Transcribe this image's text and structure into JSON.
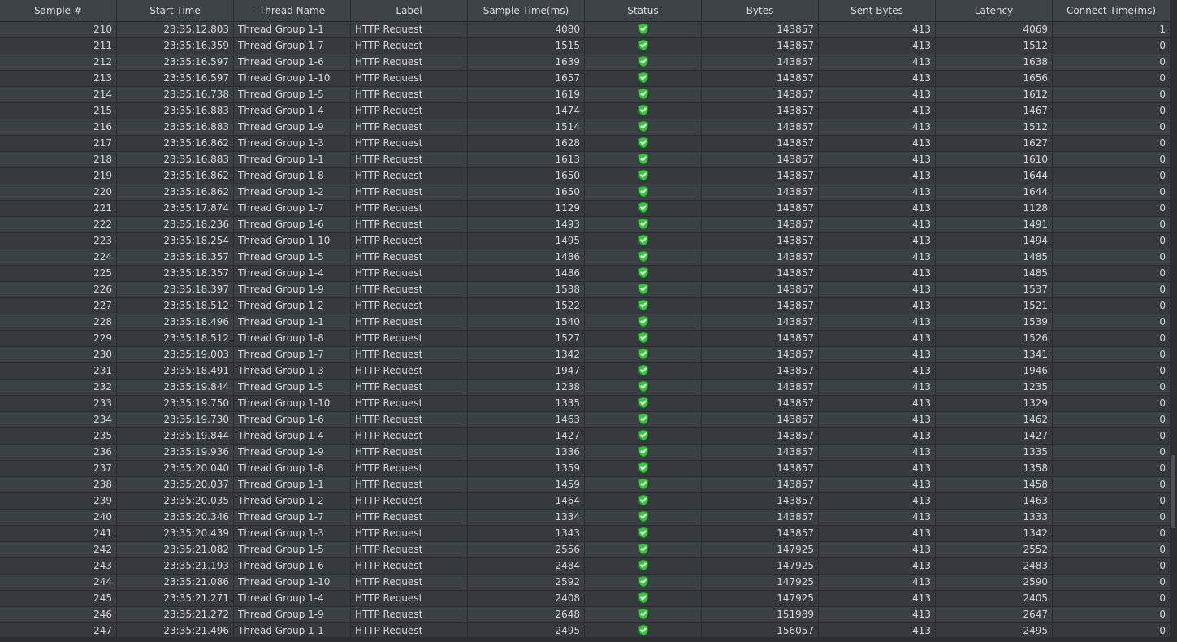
{
  "columns": [
    "Sample #",
    "Start Time",
    "Thread Name",
    "Label",
    "Sample Time(ms)",
    "Status",
    "Bytes",
    "Sent Bytes",
    "Latency",
    "Connect Time(ms)"
  ],
  "status_icon": "success-shield-icon",
  "colors": {
    "success": "#33c93a"
  },
  "rows": [
    [
      "210",
      "23:35:12.803",
      "Thread Group 1-1",
      "HTTP Request",
      "4080",
      "ok",
      "143857",
      "413",
      "4069",
      "1"
    ],
    [
      "211",
      "23:35:16.359",
      "Thread Group 1-7",
      "HTTP Request",
      "1515",
      "ok",
      "143857",
      "413",
      "1512",
      "0"
    ],
    [
      "212",
      "23:35:16.597",
      "Thread Group 1-6",
      "HTTP Request",
      "1639",
      "ok",
      "143857",
      "413",
      "1638",
      "0"
    ],
    [
      "213",
      "23:35:16.597",
      "Thread Group 1-10",
      "HTTP Request",
      "1657",
      "ok",
      "143857",
      "413",
      "1656",
      "0"
    ],
    [
      "214",
      "23:35:16.738",
      "Thread Group 1-5",
      "HTTP Request",
      "1619",
      "ok",
      "143857",
      "413",
      "1612",
      "0"
    ],
    [
      "215",
      "23:35:16.883",
      "Thread Group 1-4",
      "HTTP Request",
      "1474",
      "ok",
      "143857",
      "413",
      "1467",
      "0"
    ],
    [
      "216",
      "23:35:16.883",
      "Thread Group 1-9",
      "HTTP Request",
      "1514",
      "ok",
      "143857",
      "413",
      "1512",
      "0"
    ],
    [
      "217",
      "23:35:16.862",
      "Thread Group 1-3",
      "HTTP Request",
      "1628",
      "ok",
      "143857",
      "413",
      "1627",
      "0"
    ],
    [
      "218",
      "23:35:16.883",
      "Thread Group 1-1",
      "HTTP Request",
      "1613",
      "ok",
      "143857",
      "413",
      "1610",
      "0"
    ],
    [
      "219",
      "23:35:16.862",
      "Thread Group 1-8",
      "HTTP Request",
      "1650",
      "ok",
      "143857",
      "413",
      "1644",
      "0"
    ],
    [
      "220",
      "23:35:16.862",
      "Thread Group 1-2",
      "HTTP Request",
      "1650",
      "ok",
      "143857",
      "413",
      "1644",
      "0"
    ],
    [
      "221",
      "23:35:17.874",
      "Thread Group 1-7",
      "HTTP Request",
      "1129",
      "ok",
      "143857",
      "413",
      "1128",
      "0"
    ],
    [
      "222",
      "23:35:18.236",
      "Thread Group 1-6",
      "HTTP Request",
      "1493",
      "ok",
      "143857",
      "413",
      "1491",
      "0"
    ],
    [
      "223",
      "23:35:18.254",
      "Thread Group 1-10",
      "HTTP Request",
      "1495",
      "ok",
      "143857",
      "413",
      "1494",
      "0"
    ],
    [
      "224",
      "23:35:18.357",
      "Thread Group 1-5",
      "HTTP Request",
      "1486",
      "ok",
      "143857",
      "413",
      "1485",
      "0"
    ],
    [
      "225",
      "23:35:18.357",
      "Thread Group 1-4",
      "HTTP Request",
      "1486",
      "ok",
      "143857",
      "413",
      "1485",
      "0"
    ],
    [
      "226",
      "23:35:18.397",
      "Thread Group 1-9",
      "HTTP Request",
      "1538",
      "ok",
      "143857",
      "413",
      "1537",
      "0"
    ],
    [
      "227",
      "23:35:18.512",
      "Thread Group 1-2",
      "HTTP Request",
      "1522",
      "ok",
      "143857",
      "413",
      "1521",
      "0"
    ],
    [
      "228",
      "23:35:18.496",
      "Thread Group 1-1",
      "HTTP Request",
      "1540",
      "ok",
      "143857",
      "413",
      "1539",
      "0"
    ],
    [
      "229",
      "23:35:18.512",
      "Thread Group 1-8",
      "HTTP Request",
      "1527",
      "ok",
      "143857",
      "413",
      "1526",
      "0"
    ],
    [
      "230",
      "23:35:19.003",
      "Thread Group 1-7",
      "HTTP Request",
      "1342",
      "ok",
      "143857",
      "413",
      "1341",
      "0"
    ],
    [
      "231",
      "23:35:18.491",
      "Thread Group 1-3",
      "HTTP Request",
      "1947",
      "ok",
      "143857",
      "413",
      "1946",
      "0"
    ],
    [
      "232",
      "23:35:19.844",
      "Thread Group 1-5",
      "HTTP Request",
      "1238",
      "ok",
      "143857",
      "413",
      "1235",
      "0"
    ],
    [
      "233",
      "23:35:19.750",
      "Thread Group 1-10",
      "HTTP Request",
      "1335",
      "ok",
      "143857",
      "413",
      "1329",
      "0"
    ],
    [
      "234",
      "23:35:19.730",
      "Thread Group 1-6",
      "HTTP Request",
      "1463",
      "ok",
      "143857",
      "413",
      "1462",
      "0"
    ],
    [
      "235",
      "23:35:19.844",
      "Thread Group 1-4",
      "HTTP Request",
      "1427",
      "ok",
      "143857",
      "413",
      "1427",
      "0"
    ],
    [
      "236",
      "23:35:19.936",
      "Thread Group 1-9",
      "HTTP Request",
      "1336",
      "ok",
      "143857",
      "413",
      "1335",
      "0"
    ],
    [
      "237",
      "23:35:20.040",
      "Thread Group 1-8",
      "HTTP Request",
      "1359",
      "ok",
      "143857",
      "413",
      "1358",
      "0"
    ],
    [
      "238",
      "23:35:20.037",
      "Thread Group 1-1",
      "HTTP Request",
      "1459",
      "ok",
      "143857",
      "413",
      "1458",
      "0"
    ],
    [
      "239",
      "23:35:20.035",
      "Thread Group 1-2",
      "HTTP Request",
      "1464",
      "ok",
      "143857",
      "413",
      "1463",
      "0"
    ],
    [
      "240",
      "23:35:20.346",
      "Thread Group 1-7",
      "HTTP Request",
      "1334",
      "ok",
      "143857",
      "413",
      "1333",
      "0"
    ],
    [
      "241",
      "23:35:20.439",
      "Thread Group 1-3",
      "HTTP Request",
      "1343",
      "ok",
      "143857",
      "413",
      "1342",
      "0"
    ],
    [
      "242",
      "23:35:21.082",
      "Thread Group 1-5",
      "HTTP Request",
      "2556",
      "ok",
      "147925",
      "413",
      "2552",
      "0"
    ],
    [
      "243",
      "23:35:21.193",
      "Thread Group 1-6",
      "HTTP Request",
      "2484",
      "ok",
      "147925",
      "413",
      "2483",
      "0"
    ],
    [
      "244",
      "23:35:21.086",
      "Thread Group 1-10",
      "HTTP Request",
      "2592",
      "ok",
      "147925",
      "413",
      "2590",
      "0"
    ],
    [
      "245",
      "23:35:21.271",
      "Thread Group 1-4",
      "HTTP Request",
      "2408",
      "ok",
      "147925",
      "413",
      "2405",
      "0"
    ],
    [
      "246",
      "23:35:21.272",
      "Thread Group 1-9",
      "HTTP Request",
      "2648",
      "ok",
      "151989",
      "413",
      "2647",
      "0"
    ],
    [
      "247",
      "23:35:21.496",
      "Thread Group 1-1",
      "HTTP Request",
      "2495",
      "ok",
      "156057",
      "413",
      "2495",
      "0"
    ]
  ]
}
